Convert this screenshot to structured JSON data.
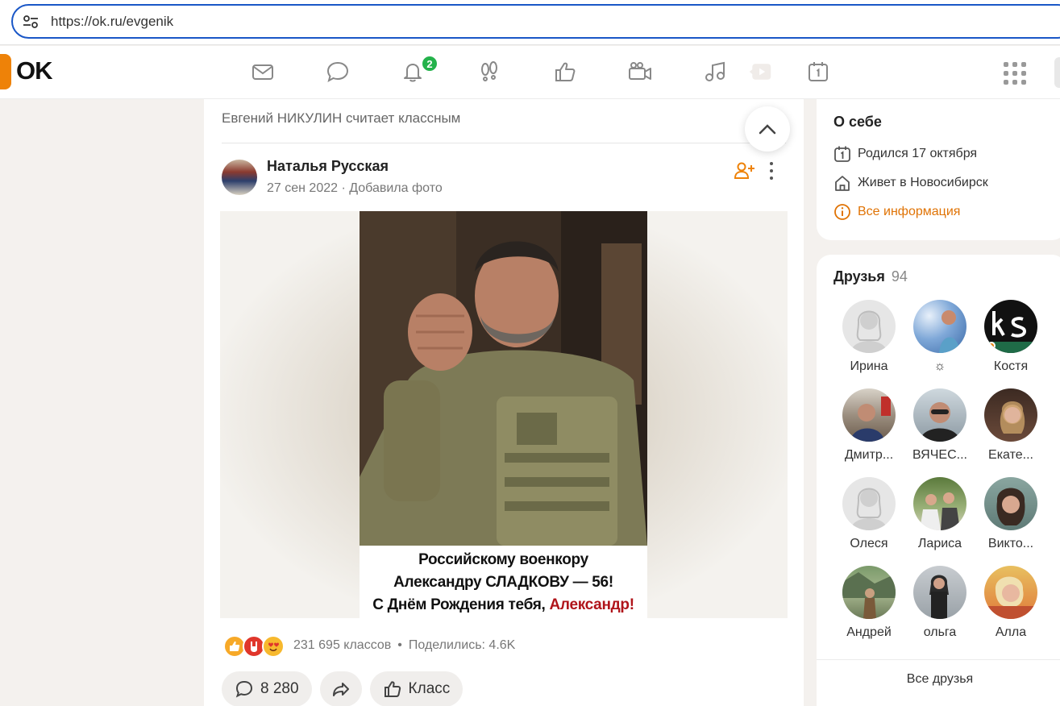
{
  "browser": {
    "url": "https://ok.ru/evgenik"
  },
  "nav": {
    "logo": "OK",
    "notifications_badge": "2",
    "icons": [
      "mail-icon",
      "chat-icon",
      "bell-icon",
      "guests-icon",
      "like-icon",
      "video-icon",
      "music-icon",
      "video-play-icon",
      "calendar-icon",
      "apps-grid-icon"
    ]
  },
  "feed": {
    "header": "Евгений НИКУЛИН считает классным",
    "post": {
      "author": "Наталья Русская",
      "date": "27 сен 2022",
      "separator": "·",
      "action": "Добавила фото",
      "image_caption": {
        "line1": "Российскому военкору",
        "line2": "Александру СЛАДКОВУ — 56!",
        "line3_prefix": "С Днём Рождения тебя, ",
        "line3_name": "Александр!"
      },
      "classes": "231 695 классов",
      "bullet": "•",
      "shared": "Поделились: 4.6K",
      "comments_count": "8 280",
      "class_label": "Класс"
    }
  },
  "about": {
    "title": "О себе",
    "born": "Родился 17 октября",
    "lives": "Живет в Новосибирск",
    "all_info": "Все информация"
  },
  "friends": {
    "title": "Друзья",
    "count": "94",
    "list": [
      {
        "name": "Ирина"
      },
      {
        "name": "☼"
      },
      {
        "name": "Костя"
      },
      {
        "name": "Дмитр..."
      },
      {
        "name": "ВЯЧЕС..."
      },
      {
        "name": "Екате..."
      },
      {
        "name": "Олеся"
      },
      {
        "name": "Лариса"
      },
      {
        "name": "Викто..."
      },
      {
        "name": "Андрей"
      },
      {
        "name": "ольга"
      },
      {
        "name": "Алла"
      }
    ],
    "all_label": "Все друзья"
  },
  "colors": {
    "accent": "#ee8208",
    "badge": "#24b24b",
    "url_border": "#1a57c7"
  }
}
